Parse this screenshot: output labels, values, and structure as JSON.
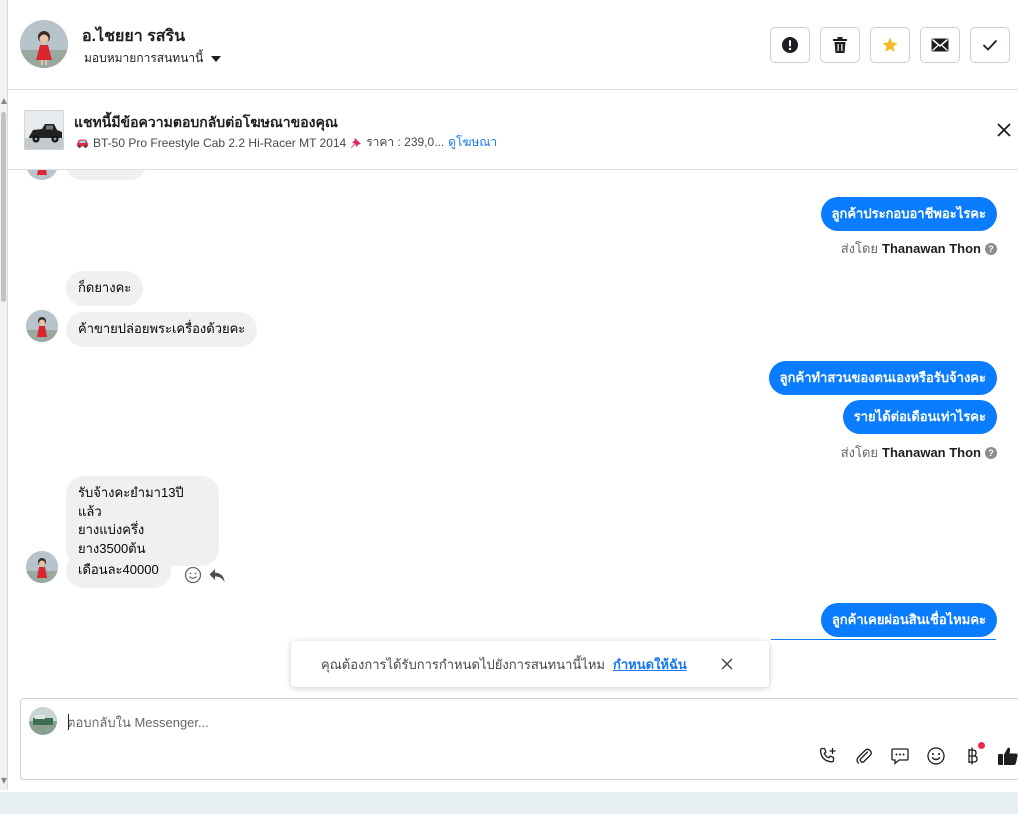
{
  "header": {
    "contact_name": "อ.ไชยยา รสริน",
    "assign_label": "มอบหมายการสนทนานี้",
    "buttons": [
      {
        "icon": "alert-icon"
      },
      {
        "icon": "trash-icon"
      },
      {
        "icon": "star-icon"
      },
      {
        "icon": "mail-icon"
      },
      {
        "icon": "check-icon"
      }
    ],
    "star_color": "#f7b928"
  },
  "ad_banner": {
    "title": "แชทนี้มีข้อความตอบกลับต่อโฆษณาของคุณ",
    "car_label": "BT-50 Pro Freestyle Cab 2.2 Hi-Racer MT 2014",
    "price_label": "ราคา : 239,0...",
    "view_ad_link": "ดูโฆษณา"
  },
  "messages": {
    "out_1": "ลูกค้าประกอบอาชีพอะไรคะ",
    "sent_by_prefix": "ส่งโดย",
    "sent_by_name": "Thanawan Thon",
    "in_1": "ก็ดยางคะ",
    "in_2": "ค้าขายปล่อยพระเครื่องด้วยคะ",
    "out_2": "ลูกค้าทำสวนของตนเองหรือรับจ้างคะ",
    "out_3": "รายได้ต่อเดือนเท่าไรคะ",
    "in_3_line1": "รับจ้างคะยำมา13ปีแล้ว",
    "in_3_line2": "ยางแบ่งครึ่ง",
    "in_3_line3": "ยาง3500ต้น",
    "in_4": "เดือนละ40000",
    "out_4": "ลูกค้าเคยผ่อนสินเชื่อไหมคะ"
  },
  "suggestion": {
    "text": "คุณต้องการได้รับการกำหนดไปยังการสนทนานี้ไหม",
    "link": "กำหนดให้ฉัน"
  },
  "composer": {
    "placeholder": "ตอบกลับใน Messenger...",
    "tools": [
      "phone-plus-icon",
      "paperclip-icon",
      "saved-reply-icon",
      "emoji-icon",
      "baht-icon",
      "thumbs-up-icon"
    ]
  },
  "colors": {
    "outgoing_bubble": "#0a7cff",
    "incoming_bubble": "#f0f0f0",
    "link": "#1877f2"
  }
}
